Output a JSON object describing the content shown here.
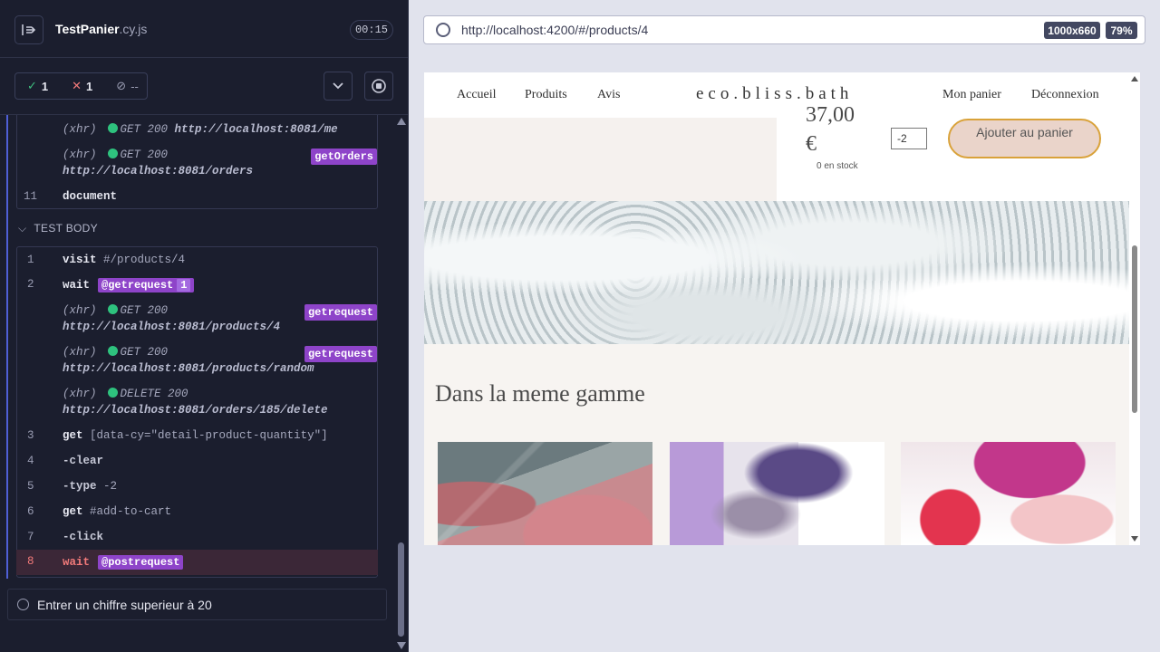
{
  "spec": {
    "name": "TestPanier",
    "ext": ".cy.js",
    "timer": "00:15"
  },
  "stats": {
    "passed": "1",
    "failed": "1",
    "pending": "--"
  },
  "hook_log": {
    "row1_xhr": "(xhr)",
    "row1_method": "GET 200",
    "row1_url": "http://localhost:8081/me",
    "row2_xhr": "(xhr)",
    "row2_method": "GET 200",
    "row2_url": "http://localhost:8081/orders",
    "row2_alias": "getOrders",
    "row3_num": "11",
    "row3_cmd": "document"
  },
  "test_body": {
    "section_label": "TEST BODY",
    "commands": [
      {
        "num": "1",
        "cmd": "visit",
        "arg": "#/products/4"
      },
      {
        "num": "2",
        "cmd": "wait",
        "alias": "@getrequest",
        "count": "1"
      },
      {
        "xhr": "(xhr)",
        "method": "GET 200",
        "url": "http://localhost:8081/products/4",
        "alias": "getrequest"
      },
      {
        "xhr": "(xhr)",
        "method": "GET 200",
        "url": "http://localhost:8081/products/random",
        "alias": "getrequest"
      },
      {
        "xhr": "(xhr)",
        "method": "DELETE 200",
        "url": "http://localhost:8081/orders/185/delete"
      },
      {
        "num": "3",
        "cmd": "get",
        "arg": "[data-cy=\"detail-product-quantity\"]"
      },
      {
        "num": "4",
        "cmd": "-clear"
      },
      {
        "num": "5",
        "cmd": "-type",
        "arg": "-2"
      },
      {
        "num": "6",
        "cmd": "get",
        "arg": "#add-to-cart"
      },
      {
        "num": "7",
        "cmd": "-click"
      },
      {
        "num": "8",
        "cmd": "wait",
        "alias": "@postrequest"
      }
    ]
  },
  "second_test": "Entrer un chiffre superieur à 20",
  "browser": {
    "url": "http://localhost:4200/#/products/4",
    "viewport": "1000x660",
    "zoom": "79%"
  },
  "app": {
    "nav": [
      "Accueil",
      "Produits",
      "Avis"
    ],
    "logo": "eco.bliss.bath",
    "nav_right": [
      "Mon panier",
      "Déconnexion"
    ],
    "price_line1": "37,00",
    "price_line2": "€",
    "stock": "0 en stock",
    "quantity": "-2",
    "add_button": "Ajouter au panier",
    "gamme_title": "Dans la meme gamme"
  }
}
